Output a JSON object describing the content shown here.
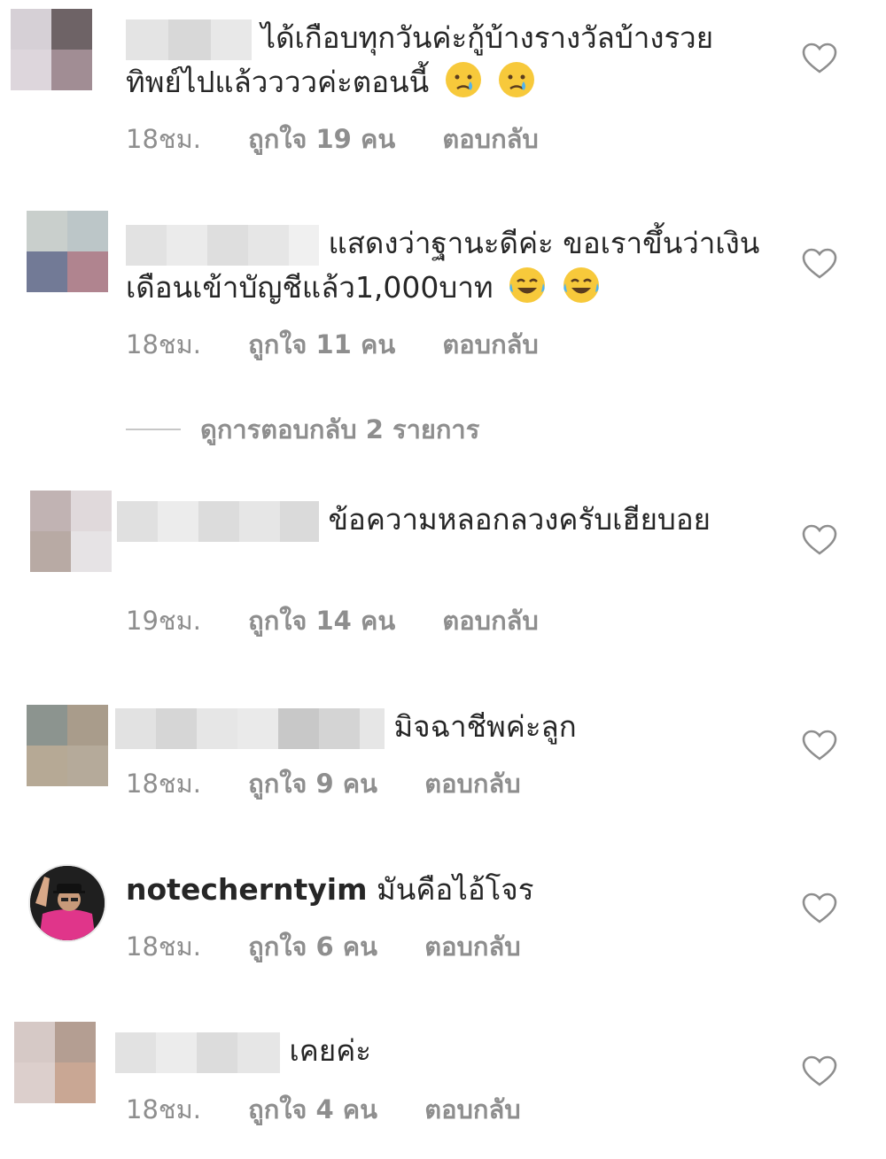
{
  "comments": [
    {
      "text": "ได้เกือบทุกวันค่ะกู้บ้างรางวัลบ้างรวยทิพย์ไปแล้ววววค่ะตอนนี้",
      "emoji": [
        "crying-face",
        "crying-face"
      ],
      "time": "18ชม.",
      "likes": "ถูกใจ 19 คน",
      "reply": "ตอบกลับ"
    },
    {
      "text": "แสดงว่าฐานะดีค่ะ ขอเราขึ้นว่าเงินเดือนเข้าบัญชีแล้ว1,000บาท",
      "emoji": [
        "tears-of-joy",
        "tears-of-joy"
      ],
      "time": "18ชม.",
      "likes": "ถูกใจ 11 คน",
      "reply": "ตอบกลับ"
    },
    {
      "text": "ข้อความหลอกลวงครับเฮียบอย",
      "time": "19ชม.",
      "likes": "ถูกใจ 14 คน",
      "reply": "ตอบกลับ"
    },
    {
      "text": "มิจฉาชีพค่ะลูก",
      "time": "18ชม.",
      "likes": "ถูกใจ 9 คน",
      "reply": "ตอบกลับ"
    },
    {
      "username": "notecherntyim",
      "text": "มันคือไอ้โจร",
      "time": "18ชม.",
      "likes": "ถูกใจ 6 คน",
      "reply": "ตอบกลับ"
    },
    {
      "text": "เคยค่ะ",
      "time": "18ชม.",
      "likes": "ถูกใจ 4 คน",
      "reply": "ตอบกลับ"
    }
  ],
  "view_replies": "ดูการตอบกลับ 2 รายการ",
  "icons": {
    "like": "heart-outline-icon"
  },
  "colors": {
    "text": "#262626",
    "secondary": "#8e8e8e"
  }
}
